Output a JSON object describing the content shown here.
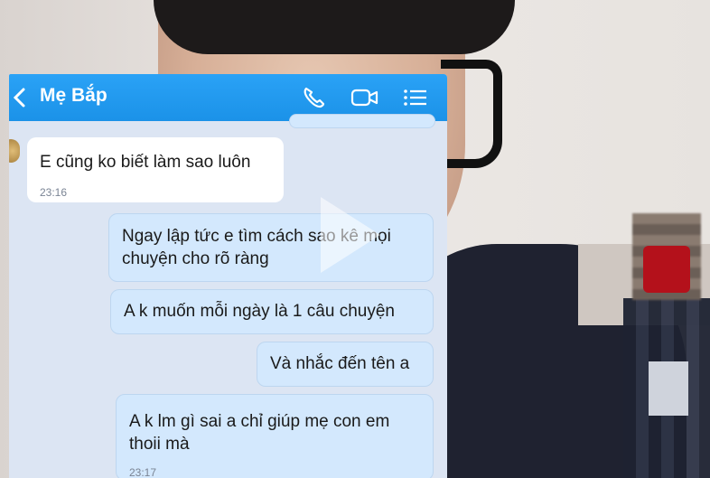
{
  "chat": {
    "contact_name": "Mẹ Bắp",
    "messages": [
      {
        "direction": "in",
        "text": "E cũng ko biết làm sao luôn",
        "time": "23:16"
      },
      {
        "direction": "out",
        "text": "Ngay lập tức e tìm cách sao kê mọi chuyện cho rõ ràng"
      },
      {
        "direction": "out",
        "text": "A k muốn mỗi ngày là 1 câu chuyện"
      },
      {
        "direction": "out",
        "text": "Và nhắc đến tên a"
      },
      {
        "direction": "out",
        "text": "A k lm gì sai a chỉ giúp mẹ con em thoii mà",
        "time": "23:17"
      }
    ]
  },
  "icons": {
    "back": "chevron-left-icon",
    "call": "phone-icon",
    "video": "video-camera-icon",
    "menu": "menu-list-icon",
    "play": "play-icon"
  },
  "colors": {
    "header": "#1b92e8",
    "chat_background": "#dce5f3",
    "outgoing_bubble": "#d3e8fd",
    "incoming_bubble": "#ffffff"
  }
}
